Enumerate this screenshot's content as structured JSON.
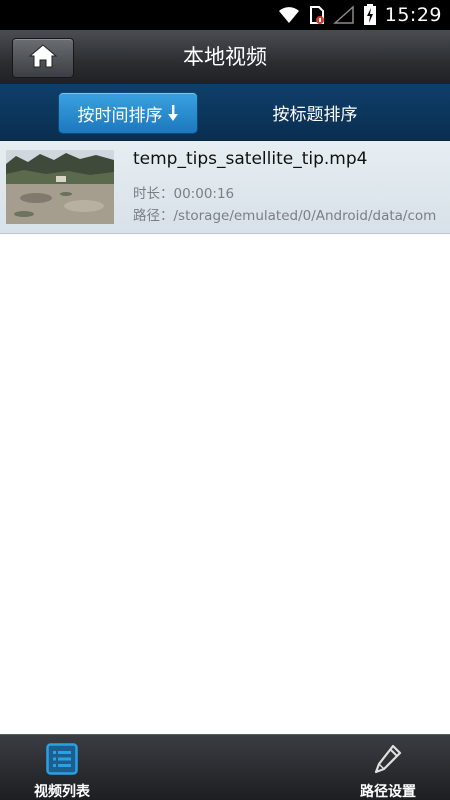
{
  "status_bar": {
    "time": "15:29",
    "icons": [
      "wifi-icon",
      "sim-card-icon",
      "signal-icon",
      "battery-charging-icon"
    ]
  },
  "header": {
    "title": "本地视频",
    "home_icon": "home-icon"
  },
  "sort_tabs": [
    {
      "label": "按时间排序",
      "active": true,
      "icon": "arrow-down-icon"
    },
    {
      "label": "按标题排序",
      "active": false
    }
  ],
  "videos": [
    {
      "name": "temp_tips_satellite_tip.mp4",
      "duration": "时长：00:00:16",
      "path": "路径：/storage/emulated/0/Android/data/com"
    }
  ],
  "bottom_nav": [
    {
      "label": "视频列表",
      "icon": "list-icon"
    },
    {
      "label": "路径设置",
      "icon": "pencil-icon"
    }
  ],
  "colors": {
    "accent": "#1d77bd",
    "list_icon": "#2aa0e6"
  }
}
